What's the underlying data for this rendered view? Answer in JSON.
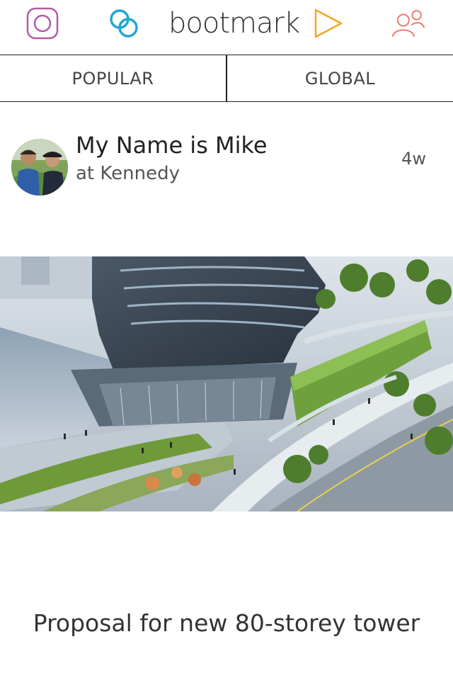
{
  "app": {
    "logo_text": "bootmark",
    "icons": {
      "instagram": "instagram-icon",
      "rings": "linked-rings-icon",
      "play": "play-icon",
      "people": "people-icon"
    },
    "colors": {
      "instagram": "#b35ba6",
      "rings": "#23a6cf",
      "play": "#f5a623",
      "people": "#ee7a6e"
    }
  },
  "tabs": [
    {
      "label": "POPULAR"
    },
    {
      "label": "GLOBAL"
    }
  ],
  "post": {
    "user_name": "My Name is Mike",
    "location": "at Kennedy",
    "age": "4w",
    "caption": "Proposal for new 80-storey tower"
  }
}
